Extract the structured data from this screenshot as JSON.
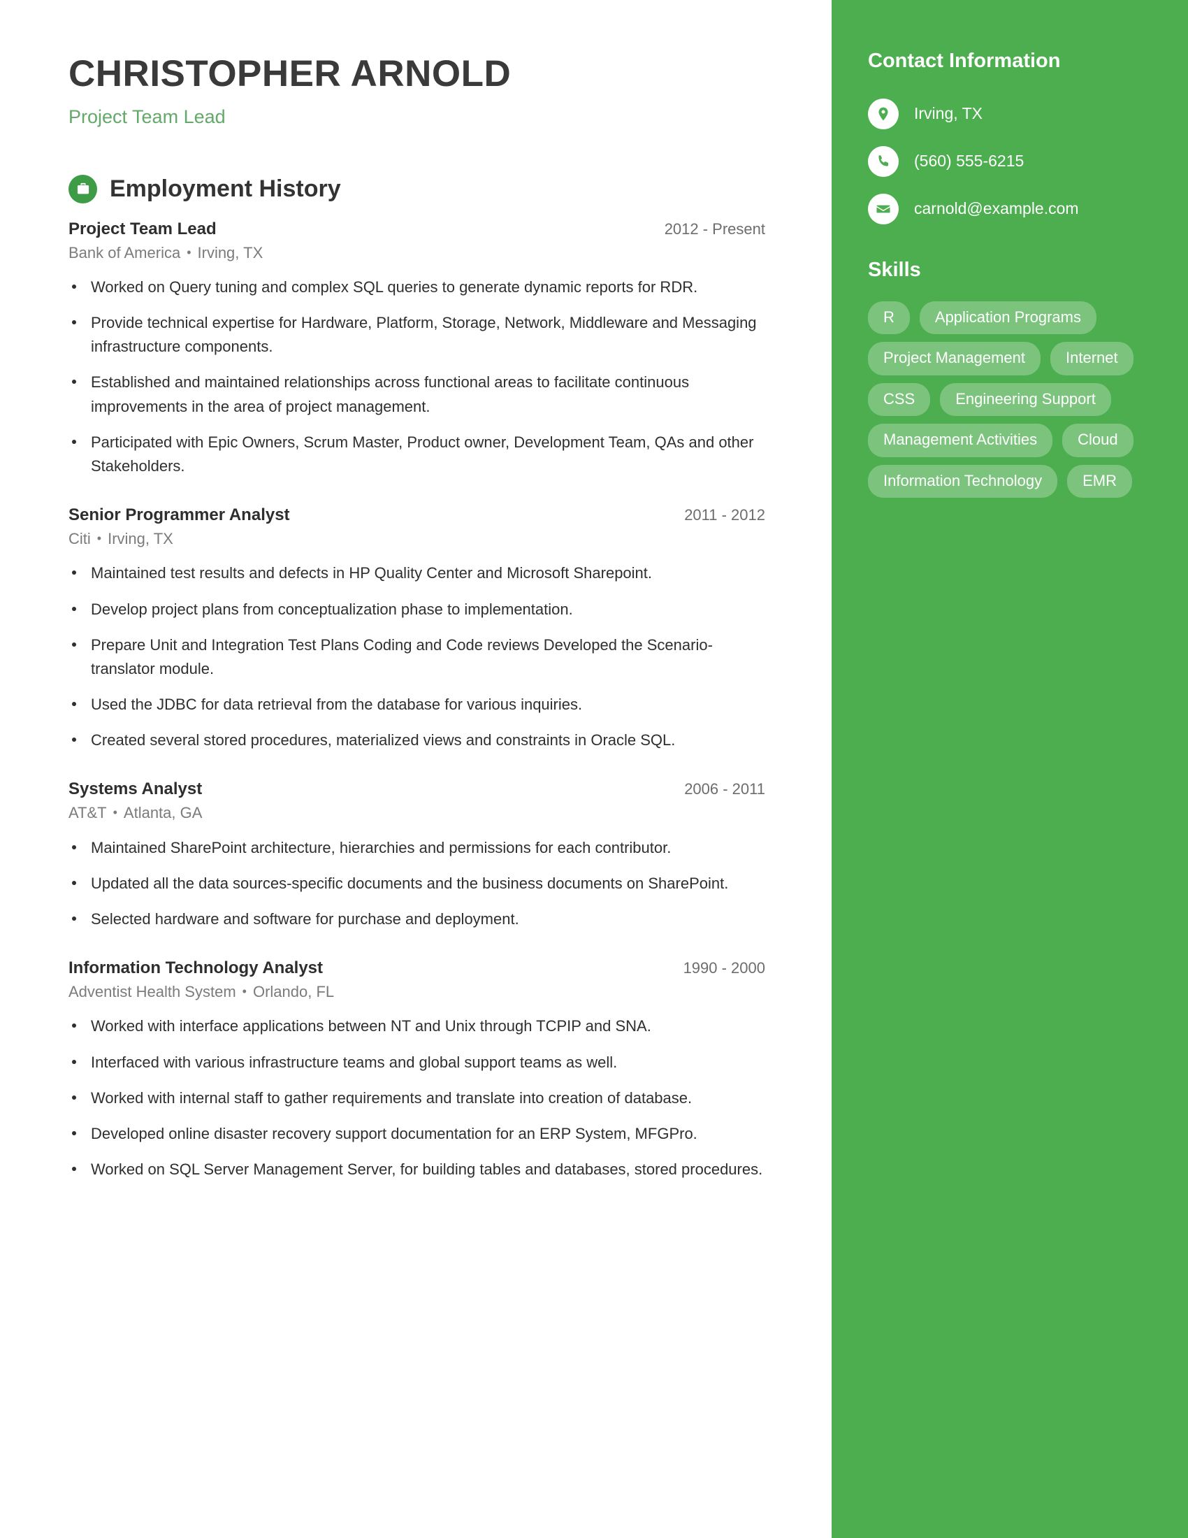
{
  "theme": {
    "sidebar_green": "#4cae4f",
    "accent_green": "#3d9c45",
    "subtitle_green": "#63a96a",
    "heading_dark": "#3a3a3a",
    "pill_bg": "rgba(255,255,255,0.27)"
  },
  "header": {
    "name": "CHRISTOPHER ARNOLD",
    "title": "Project Team Lead"
  },
  "employment": {
    "section_title": "Employment History",
    "section_icon": "briefcase-icon",
    "jobs": [
      {
        "role": "Project Team Lead",
        "dates": "2012 - Present",
        "company": "Bank of America",
        "location": "Irving, TX",
        "separator": "•",
        "bullets": [
          "Worked on Query tuning and complex SQL queries to generate dynamic reports for RDR.",
          "Provide technical expertise for Hardware, Platform, Storage, Network, Middleware and Messaging infrastructure components.",
          "Established and maintained relationships across functional areas to facilitate continuous improvements in the area of project management.",
          "Participated with Epic Owners, Scrum Master, Product owner, Development Team, QAs and other Stakeholders."
        ]
      },
      {
        "role": "Senior Programmer Analyst",
        "dates": "2011 - 2012",
        "company": "Citi",
        "location": "Irving, TX",
        "separator": "•",
        "bullets": [
          "Maintained test results and defects in HP Quality Center and Microsoft Sharepoint.",
          "Develop project plans from conceptualization phase to implementation.",
          "Prepare Unit and Integration Test Plans Coding and Code reviews Developed the Scenario-translator module.",
          "Used the JDBC for data retrieval from the database for various inquiries.",
          "Created several stored procedures, materialized views and constraints in Oracle SQL."
        ]
      },
      {
        "role": "Systems Analyst",
        "dates": "2006 - 2011",
        "company": "AT&T",
        "location": "Atlanta, GA",
        "separator": "•",
        "bullets": [
          "Maintained SharePoint architecture, hierarchies and permissions for each contributor.",
          "Updated all the data sources-specific documents and the business documents on SharePoint.",
          "Selected hardware and software for purchase and deployment."
        ]
      },
      {
        "role": "Information Technology Analyst",
        "dates": "1990 - 2000",
        "company": "Adventist Health System",
        "location": "Orlando, FL",
        "separator": "•",
        "bullets": [
          "Worked with interface applications between NT and Unix through TCPIP and SNA.",
          "Interfaced with various infrastructure teams and global support teams as well.",
          "Worked with internal staff to gather requirements and translate into creation of database.",
          "Developed online disaster recovery support documentation for an ERP System, MFGPro.",
          "Worked on SQL Server Management Server, for building tables and databases, stored procedures."
        ]
      }
    ]
  },
  "sidebar": {
    "contact_heading": "Contact Information",
    "contacts": [
      {
        "icon": "location-pin-icon",
        "value": "Irving, TX"
      },
      {
        "icon": "phone-icon",
        "value": "(560) 555-6215"
      },
      {
        "icon": "envelope-icon",
        "value": "carnold@example.com"
      }
    ],
    "skills_heading": "Skills",
    "skills": [
      "R",
      "Application Programs",
      "Project Management",
      "Internet",
      "CSS",
      "Engineering Support",
      "Management Activities",
      "Cloud",
      "Information Technology",
      "EMR"
    ]
  }
}
